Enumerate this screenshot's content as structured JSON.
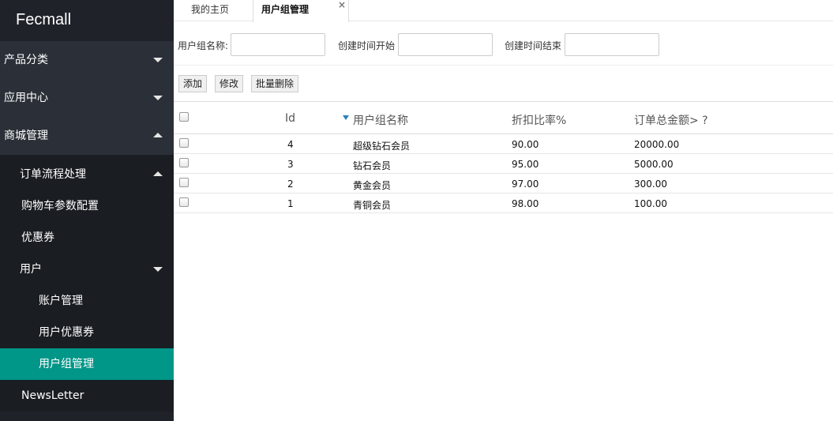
{
  "brand": "Fecmall",
  "sidebar": {
    "top_items": [
      {
        "label": "产品分类",
        "caret": "down"
      },
      {
        "label": "应用中心",
        "caret": "down"
      },
      {
        "label": "商城管理",
        "caret": "up"
      }
    ],
    "sub_items": [
      {
        "label": "订单流程处理",
        "caret": "up"
      },
      {
        "label": "购物车参数配置"
      },
      {
        "label": "优惠券"
      },
      {
        "label": "用户",
        "caret": "down"
      },
      {
        "label": "账户管理"
      },
      {
        "label": "用户优惠券"
      },
      {
        "label": "用户组管理",
        "active": true
      },
      {
        "label": "NewsLetter"
      }
    ],
    "active_color": "#009688"
  },
  "tabs": {
    "home": "我的主页",
    "current": "用户组管理",
    "close_icon": "×"
  },
  "filter": {
    "group_name_label": "用户组名称:",
    "group_name_value": "",
    "created_start_label": "创建时间开始",
    "created_start_value": "",
    "created_end_label": "创建时间结束",
    "created_end_value": ""
  },
  "toolbar": {
    "add": "添加",
    "edit": "修改",
    "batch_delete": "批量删除"
  },
  "table": {
    "columns": [
      "Id",
      "用户组名称",
      "折扣比率%",
      "订单总金额> ?"
    ],
    "sort_column": "用户组名称",
    "rows": [
      {
        "id": "4",
        "name": "超级钻石会员",
        "discount": "90.00",
        "total": "20000.00"
      },
      {
        "id": "3",
        "name": "钻石会员",
        "discount": "95.00",
        "total": "5000.00"
      },
      {
        "id": "2",
        "name": "黄金会员",
        "discount": "97.00",
        "total": "300.00"
      },
      {
        "id": "1",
        "name": "青铜会员",
        "discount": "98.00",
        "total": "100.00"
      }
    ]
  }
}
